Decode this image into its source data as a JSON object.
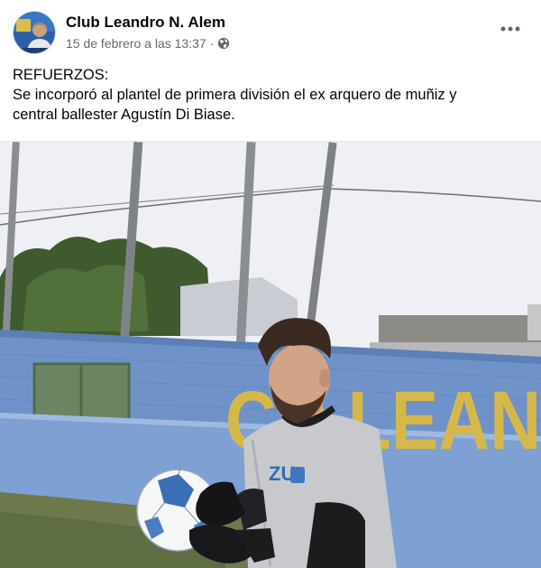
{
  "post": {
    "author": "Club Leandro N. Alem",
    "timestamp": "15 de febrero a las 13:37",
    "separator": "·",
    "privacy_icon": "globe-icon",
    "more_icon": "more-options-icon",
    "text_lines": [
      "REFUERZOS:",
      "Se incorporó al plantel de primera división el ex arquero de muñiz y",
      "central ballester Agustín Di Biase."
    ]
  },
  "photo": {
    "wall_lettering": "CD LEAN",
    "shirt_lettering": "ZU"
  },
  "colors": {
    "wall_blue": "#6f93c9",
    "lettering_yellow": "#d6b84a",
    "muted_text": "#65676b"
  }
}
